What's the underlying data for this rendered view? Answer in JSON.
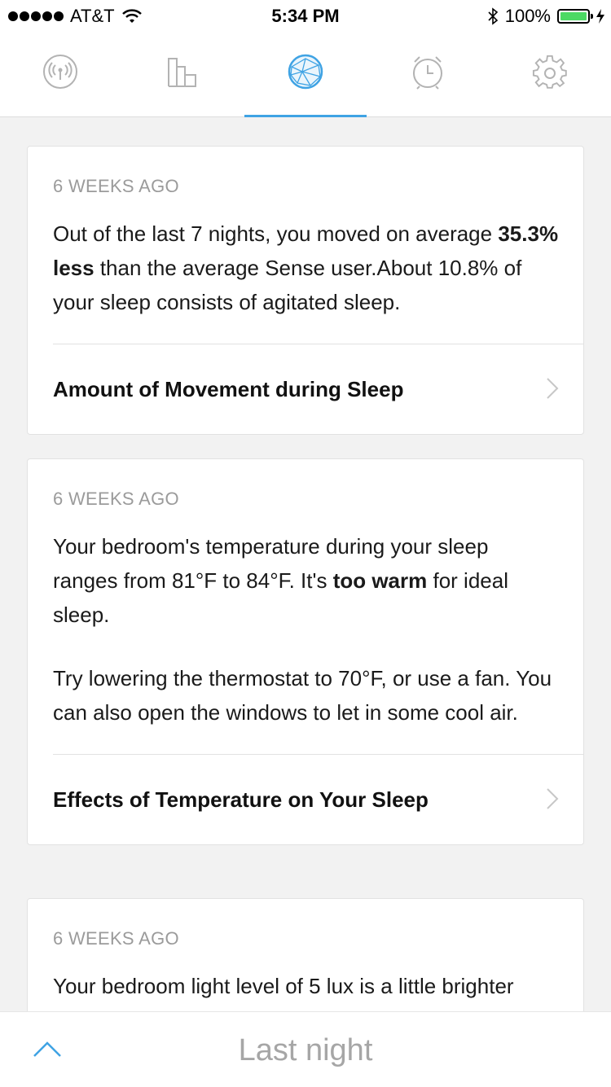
{
  "status_bar": {
    "carrier": "AT&T",
    "time": "5:34 PM",
    "battery": "100%"
  },
  "tabs": [
    {
      "icon": "sense-icon",
      "selected": false
    },
    {
      "icon": "trends-icon",
      "selected": false
    },
    {
      "icon": "insights-icon",
      "selected": true
    },
    {
      "icon": "alarm-icon",
      "selected": false
    },
    {
      "icon": "settings-icon",
      "selected": false
    }
  ],
  "cards": [
    {
      "time": "6 WEEKS AGO",
      "body_1a": "Out of the last 7 nights, you moved on average ",
      "body_1b": "35.3% less",
      "body_1c": " than the average Sense user.About 10.8% of your sleep consists of agitated sleep.",
      "link": "Amount of Movement during Sleep"
    },
    {
      "time": "6 WEEKS AGO",
      "body_1a": "Your bedroom's temperature during your sleep ranges from 81°F to 84°F. It's ",
      "body_1b": "too warm",
      "body_1c": " for ideal sleep.",
      "body_2": "Try lowering the thermostat to 70°F, or use a fan. You can also open the windows to let in some cool air.",
      "link": "Effects of Temperature on Your Sleep"
    },
    {
      "time": "6 WEEKS AGO",
      "body_1a": "Your bedroom light level of 5 lux is a little brighter"
    }
  ],
  "bottom_bar": {
    "title": "Last night"
  },
  "colors": {
    "accent": "#3fa3e4",
    "background": "#f2f2f2",
    "muted_text": "#9b9b9b"
  }
}
